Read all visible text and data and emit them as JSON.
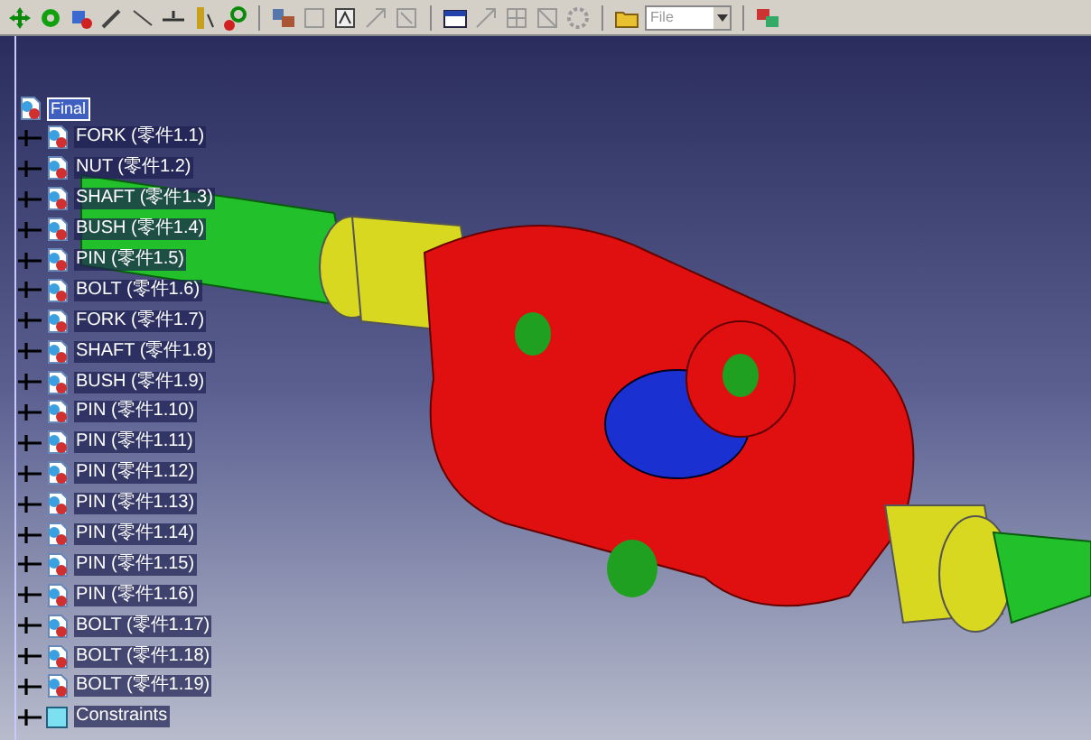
{
  "toolbar": {
    "dropdown_value": "File"
  },
  "tree": {
    "root": "Final",
    "root_selected": true,
    "children": [
      {
        "kind": "part",
        "label": "FORK (零件1.1)"
      },
      {
        "kind": "part",
        "label": "NUT (零件1.2)"
      },
      {
        "kind": "part",
        "label": "SHAFT (零件1.3)"
      },
      {
        "kind": "part",
        "label": "BUSH (零件1.4)"
      },
      {
        "kind": "part",
        "label": "PIN (零件1.5)"
      },
      {
        "kind": "part",
        "label": "BOLT (零件1.6)"
      },
      {
        "kind": "part",
        "label": "FORK (零件1.7)"
      },
      {
        "kind": "part",
        "label": "SHAFT (零件1.8)"
      },
      {
        "kind": "part",
        "label": "BUSH (零件1.9)"
      },
      {
        "kind": "part",
        "label": "PIN (零件1.10)"
      },
      {
        "kind": "part",
        "label": "PIN (零件1.11)"
      },
      {
        "kind": "part",
        "label": "PIN (零件1.12)"
      },
      {
        "kind": "part",
        "label": "PIN (零件1.13)"
      },
      {
        "kind": "part",
        "label": "PIN (零件1.14)"
      },
      {
        "kind": "part",
        "label": "PIN (零件1.15)"
      },
      {
        "kind": "part",
        "label": "PIN (零件1.16)"
      },
      {
        "kind": "part",
        "label": "BOLT (零件1.17)"
      },
      {
        "kind": "part",
        "label": "BOLT (零件1.18)"
      },
      {
        "kind": "part",
        "label": "BOLT (零件1.19)"
      },
      {
        "kind": "constraints",
        "label": "Constraints"
      }
    ]
  }
}
